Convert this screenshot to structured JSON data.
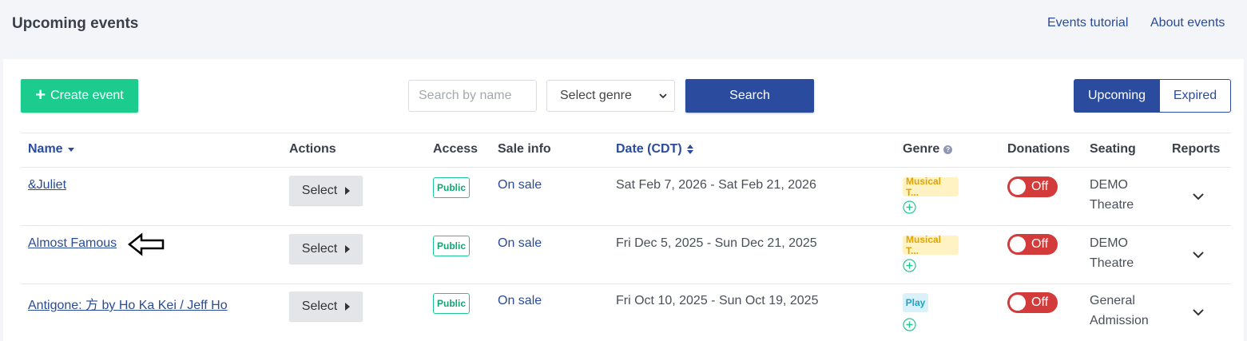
{
  "header": {
    "title": "Upcoming events",
    "links": [
      "Events tutorial",
      "About events"
    ]
  },
  "toolbar": {
    "create_label": "Create event",
    "search_placeholder": "Search by name",
    "genre_select_value": "Select genre",
    "search_label": "Search",
    "view_toggle": [
      "Upcoming",
      "Expired"
    ],
    "active_view": "Upcoming"
  },
  "table": {
    "columns": [
      "Name",
      "Actions",
      "Access",
      "Sale info",
      "Date (CDT)",
      "Genre",
      "Donations",
      "Seating",
      "Reports"
    ],
    "rows": [
      {
        "name": "&Juliet",
        "action": "Select",
        "access": "Public",
        "sale": "On sale",
        "date": "Sat Feb 7, 2026 - Sat Feb 21, 2026",
        "genre": "Musical T...",
        "donations": "Off",
        "seating": [
          "DEMO",
          "Theatre"
        ]
      },
      {
        "name": "Almost Famous",
        "action": "Select",
        "access": "Public",
        "sale": "On sale",
        "date": "Fri Dec 5, 2025 - Sun Dec 21, 2025",
        "genre": "Musical T...",
        "donations": "Off",
        "seating": [
          "DEMO",
          "Theatre"
        ]
      },
      {
        "name": "Antigone: 方 by Ho Ka Kei / Jeff Ho",
        "action": "Select",
        "access": "Public",
        "sale": "On sale",
        "date": "Fri Oct 10, 2025 - Sun Oct 19, 2025",
        "genre": "Play",
        "donations": "Off",
        "seating": [
          "General",
          "Admission"
        ]
      }
    ]
  },
  "colors": {
    "primary": "#2a4b9e",
    "create_green": "#1ccb8e",
    "off_red": "#d33b3b",
    "musical_bg": "#fff3c4",
    "play_bg": "#dbf1f9"
  }
}
